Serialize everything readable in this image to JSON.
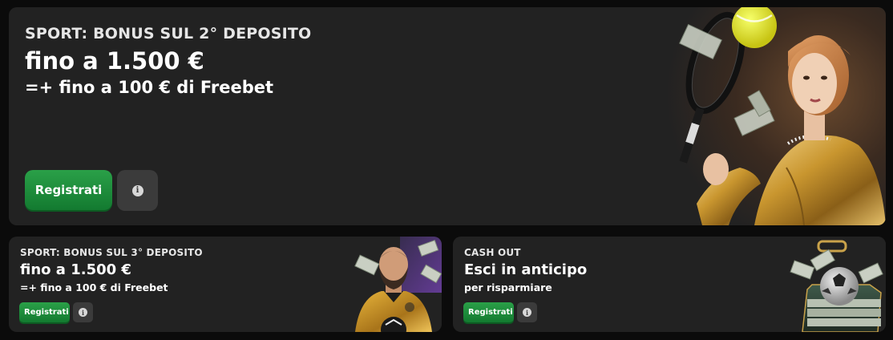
{
  "hero": {
    "eyebrow": "SPORT: BONUS SUL 2° DEPOSITO",
    "headline": "fino a 1.500 €",
    "subline": "=+ fino a 100 € di Freebet",
    "register_label": "Registrati",
    "info_icon": "info-icon"
  },
  "promo_left": {
    "eyebrow": "SPORT: BONUS SUL 3° DEPOSITO",
    "headline": "fino a 1.500 €",
    "subline": "=+ fino a 100 € di Freebet",
    "register_label": "Registrati",
    "info_icon": "info-icon"
  },
  "promo_right": {
    "eyebrow": "CASH OUT",
    "headline": "Esci in anticipo",
    "subline": "per risparmiare",
    "register_label": "Registrati",
    "info_icon": "info-icon"
  },
  "colors": {
    "card_bg": "#222222",
    "page_bg": "#0b0b0b",
    "button_green": "#1f8c3c",
    "info_button_bg": "#3b3b3b"
  }
}
